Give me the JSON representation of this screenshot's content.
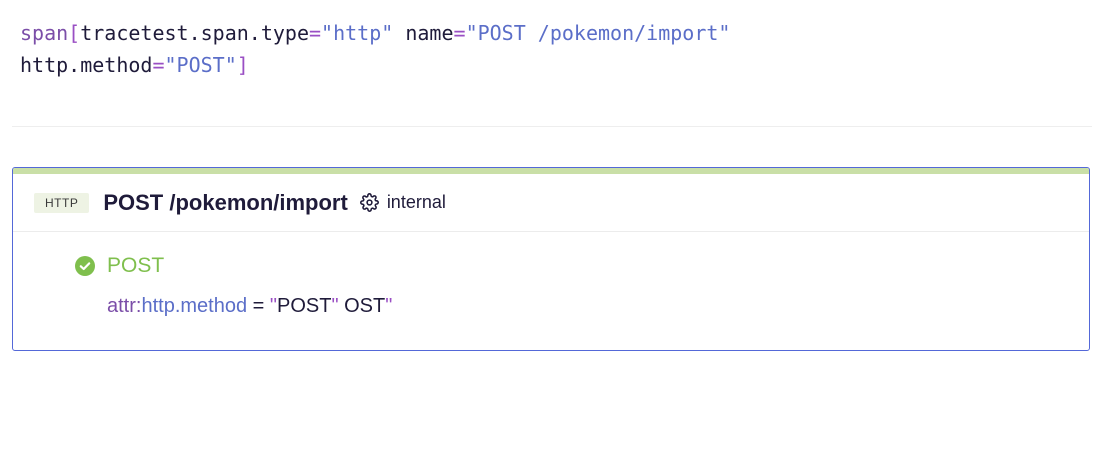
{
  "selector": {
    "line1": {
      "keyword": "span",
      "open": "[",
      "attr1": "tracetest.span.type",
      "eq1": "=",
      "val1": "\"http\"",
      "attr2": "name",
      "eq2": "=",
      "val2": "\"POST /pokemon/import\""
    },
    "line2": {
      "attr3": "http.method",
      "eq3": "=",
      "val3": "\"POST\"",
      "close": "]"
    }
  },
  "span_card": {
    "type_badge": "HTTP",
    "name": "POST /pokemon/import",
    "kind_icon": "gear-icon",
    "kind": "internal",
    "accent_color": "#c9dfa7",
    "border_color": "#5468d8",
    "assertion": {
      "status_icon": "check-circle-icon",
      "status_color": "#7fbf4d",
      "title": "POST",
      "expr_attr_prefix": "attr:",
      "expr_key": "http.method",
      "expr_op": "=",
      "expr_quote_open": "\"",
      "expr_expected": "POST",
      "expr_quote_mid": "\"",
      "expr_actual": "OST",
      "expr_quote_close": "\""
    }
  }
}
